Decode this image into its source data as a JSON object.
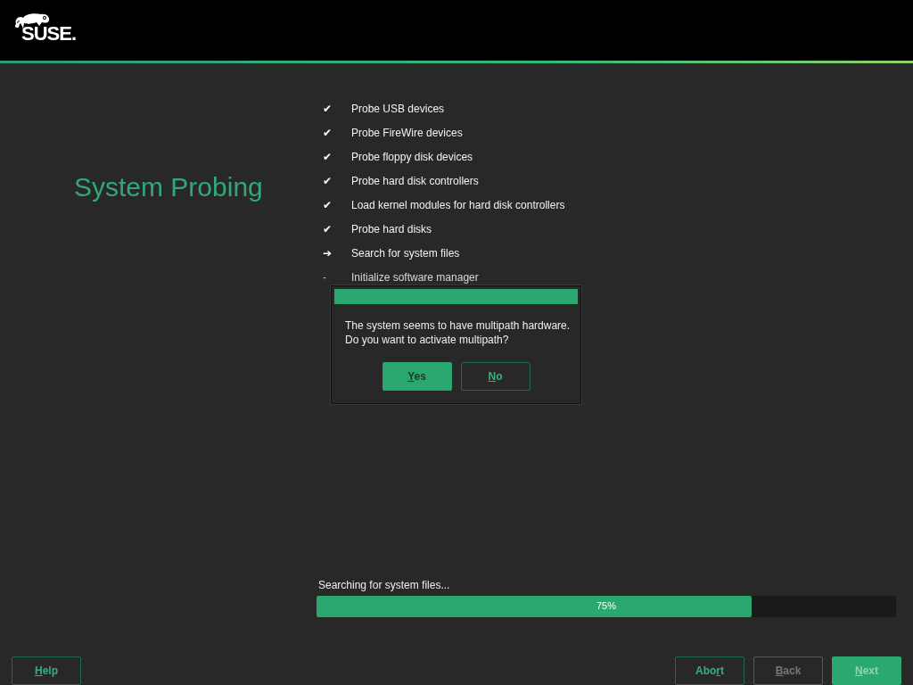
{
  "header": {
    "logo": "SUSE."
  },
  "title": "System Probing",
  "steps": [
    {
      "mark": "✔",
      "label": "Probe USB devices",
      "kind": "done"
    },
    {
      "mark": "✔",
      "label": "Probe FireWire devices",
      "kind": "done"
    },
    {
      "mark": "✔",
      "label": "Probe floppy disk devices",
      "kind": "done"
    },
    {
      "mark": "✔",
      "label": "Probe hard disk controllers",
      "kind": "done"
    },
    {
      "mark": "✔",
      "label": "Load kernel modules for hard disk controllers",
      "kind": "done"
    },
    {
      "mark": "✔",
      "label": "Probe hard disks",
      "kind": "done"
    },
    {
      "mark": "➔",
      "label": "Search for system files",
      "kind": "current"
    },
    {
      "mark": "-",
      "label": "Initialize software manager",
      "kind": "pending"
    }
  ],
  "dialog": {
    "message": "The system seems to have multipath hardware.\nDo you want to activate multipath?",
    "buttons": [
      {
        "key": "Y",
        "post": "es",
        "kind": "primary",
        "disabled": false
      },
      {
        "key": "N",
        "post": "o",
        "kind": "outline",
        "disabled": false
      }
    ]
  },
  "progress": {
    "label": "Searching for system files...",
    "reading": "75%",
    "level": 0.75
  },
  "left_buttons": [
    {
      "key": "H",
      "post": "elp",
      "kind": "outline",
      "disabled": false
    }
  ],
  "right_buttons": [
    {
      "pre": "Abo",
      "key": "r",
      "post": "t",
      "kind": "outline",
      "disabled": false
    },
    {
      "key": "B",
      "post": "ack",
      "kind": "outline",
      "disabled": true
    },
    {
      "key": "N",
      "post": "ext",
      "kind": "primary",
      "disabled": true
    }
  ]
}
